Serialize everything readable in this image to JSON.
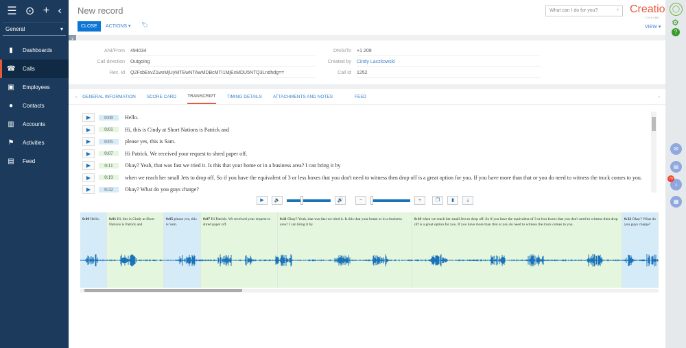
{
  "sidebar": {
    "workspace": "General",
    "items": [
      {
        "label": "Dashboards",
        "icon": "bar-chart-icon"
      },
      {
        "label": "Calls",
        "icon": "phone-icon",
        "active": true
      },
      {
        "label": "Employees",
        "icon": "badge-icon"
      },
      {
        "label": "Contacts",
        "icon": "person-icon"
      },
      {
        "label": "Accounts",
        "icon": "building-icon"
      },
      {
        "label": "Activities",
        "icon": "flag-icon"
      },
      {
        "label": "Feed",
        "icon": "chat-icon"
      }
    ]
  },
  "header": {
    "title": "New record",
    "close": "CLOSE",
    "actions": "ACTIONS ▾",
    "search_placeholder": "What can I do for you?",
    "logo": "Creatio",
    "version": "7.16.0.4461",
    "view": "VIEW ▾"
  },
  "info": {
    "ani_label": "ANI/From",
    "ani": "494034",
    "dir_label": "Call direction",
    "dir": "Outgoing",
    "rec_label": "Rec. Id",
    "rec": "Q2FsbExvZ1wxMjUyMTEwNTAwMDBcMTI1MjExMDU5NTQ3Lndhdg==",
    "dnis_label": "DNIS/To",
    "dnis": "+1 209",
    "created_label": "Created by",
    "created": "Cindy Laczkowski",
    "callid_label": "Call Id",
    "callid": "1252"
  },
  "tabs": [
    "GENERAL INFORMATION",
    "SCORE CARD",
    "TRANSCRIPT",
    "TIMING DETAILS",
    "ATTACHMENTS AND NOTES",
    "FEED"
  ],
  "active_tab": "TRANSCRIPT",
  "transcript": [
    {
      "time": "0:00",
      "text": "Hello.",
      "speaker": "a",
      "sec": 0
    },
    {
      "time": "0:01",
      "text": "Hi, this is Cindy at Short Nations is Patrick and",
      "speaker": "b",
      "sec": 1
    },
    {
      "time": "0:05",
      "text": "please yes, this is Sam.",
      "speaker": "a",
      "sec": 5
    },
    {
      "time": "0:07",
      "text": "Hi Patrick. We received your request to shred paper off.",
      "speaker": "b",
      "sec": 7
    },
    {
      "time": "0:11",
      "text": "Okay? Yeah, that was fast we tried it. Is this that your home or in a business area? I can bring it by",
      "speaker": "b",
      "sec": 11
    },
    {
      "time": "0:19",
      "text": "when we reach her small Jets to drop off. So if you have the equivalent of 3 or less boxes that you don't need to witness then drop off is a great option for you. If you have more than that or you do need to witness the truck comes to you.",
      "speaker": "b",
      "sec": 19
    },
    {
      "time": "0:32",
      "text": "Okay? What do you guys charge?",
      "speaker": "a",
      "sec": 32
    }
  ],
  "speaker_colors": {
    "a": "#d6ebf8",
    "b": "#e4f6de"
  },
  "player": {
    "volume": 0.35,
    "zoom": 0.0
  },
  "notifications": {
    "count": "70"
  }
}
